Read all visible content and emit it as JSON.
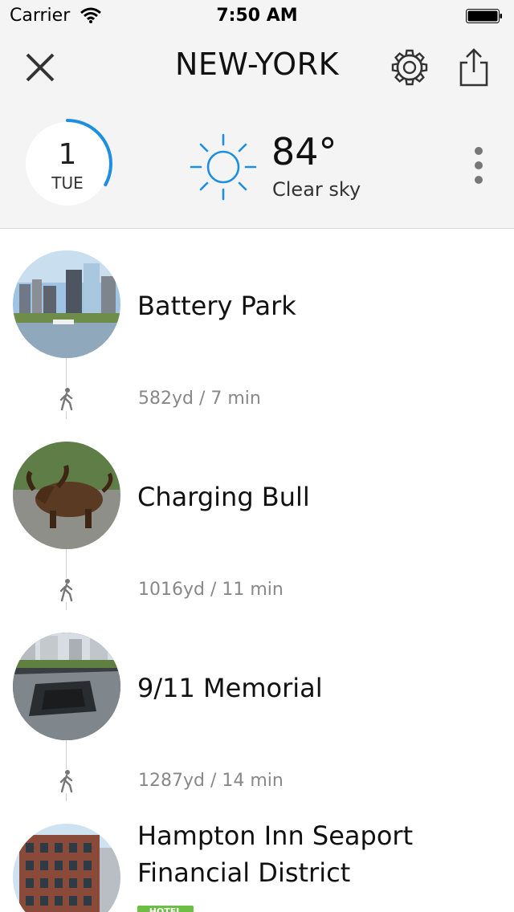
{
  "status_bar": {
    "carrier": "Carrier",
    "time": "7:50 AM"
  },
  "header": {
    "title": "NEW-YORK",
    "icons": {
      "close": "close-icon",
      "settings": "gear-icon",
      "share": "share-icon",
      "more": "more-vertical-icon"
    }
  },
  "day": {
    "number": "1",
    "weekday": "TUE",
    "progress": 0.33,
    "accent_color": "#1e8fe0"
  },
  "weather": {
    "temperature": "84°",
    "condition": "Clear sky",
    "icon": "sun-icon",
    "icon_color": "#1e8fe0"
  },
  "stops": [
    {
      "name": "Battery Park",
      "photo": "battery-park-photo"
    },
    {
      "name": "Charging Bull",
      "photo": "charging-bull-photo"
    },
    {
      "name": "9/11 Memorial",
      "photo": "memorial-photo"
    },
    {
      "name_line1": "Hampton Inn Seaport",
      "name_line2": "Financial District",
      "badge": "HOTEL",
      "photo": "hotel-photo"
    }
  ],
  "walks": [
    {
      "text": "582yd / 7 min",
      "icon": "walk-icon"
    },
    {
      "text": "1016yd / 11 min",
      "icon": "walk-icon"
    },
    {
      "text": "1287yd / 14 min",
      "icon": "walk-icon"
    }
  ],
  "colors": {
    "header_bg": "#f4f4f4",
    "hotel_badge": "#6cbe45",
    "text_secondary": "#888888"
  }
}
